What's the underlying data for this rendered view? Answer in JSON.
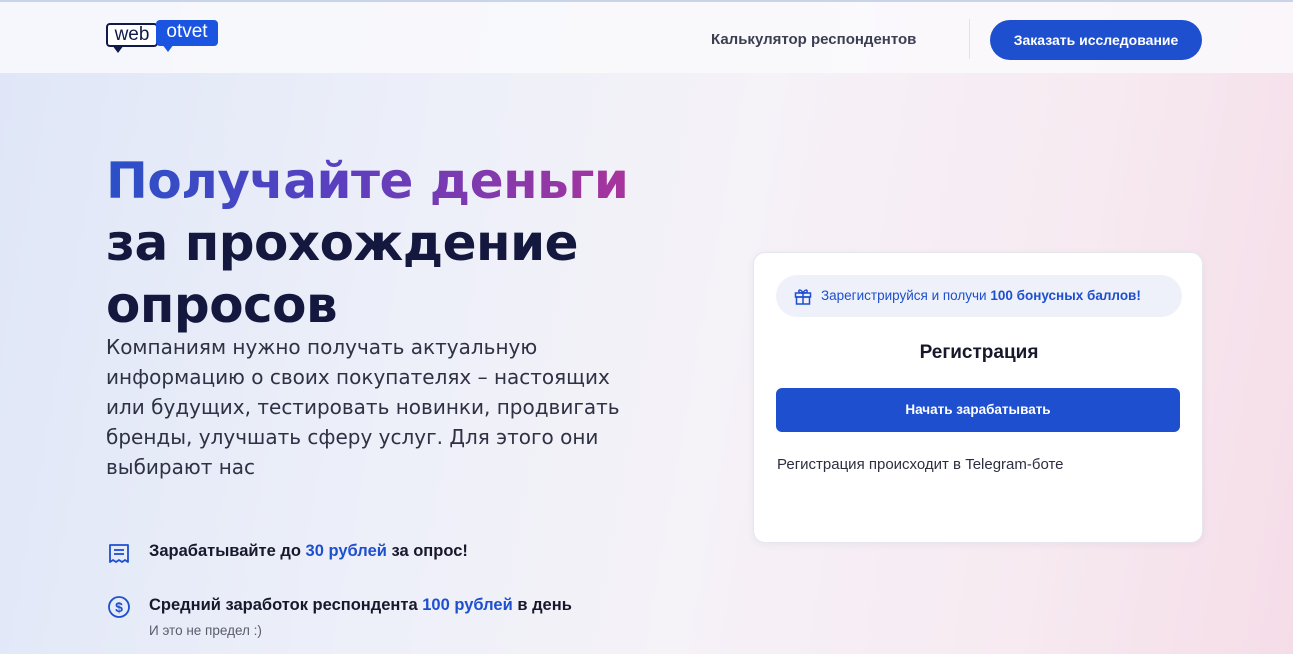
{
  "header": {
    "logo": {
      "part1": "web",
      "part2": "otvet"
    },
    "nav_calculator": "Калькулятор респондентов",
    "order_button": "Заказать исследование"
  },
  "hero": {
    "title_highlight": "Получайте деньги",
    "title_rest": "за прохождение опросов",
    "lead": "Компаниям нужно получать актуальную информацию о своих покупателях – настоящих или будущих, тестировать новинки, продвигать бренды, улучшать сферу услуг. Для этого они выбирают нас"
  },
  "features": [
    {
      "icon": "receipt-icon",
      "before": "Зарабатывайте до ",
      "highlight": "30 рублей",
      "after": " за опрос!",
      "sub": ""
    },
    {
      "icon": "dollar-coin-icon",
      "before": "Средний заработок респондента ",
      "highlight": "100 рублей",
      "after": " в день",
      "sub": "И это не предел :)"
    }
  ],
  "registration": {
    "bonus_before": "Зарегистрируйся и получи ",
    "bonus_bold": "100 бонусных баллов!",
    "title": "Регистрация",
    "start_button": "Начать зарабатывать",
    "note": "Регистрация происходит в Telegram-боте"
  },
  "colors": {
    "accent": "#1d4fce",
    "dark_navy": "#14183e",
    "gradient_start": "#2a50c8",
    "gradient_end": "#a8349c"
  }
}
